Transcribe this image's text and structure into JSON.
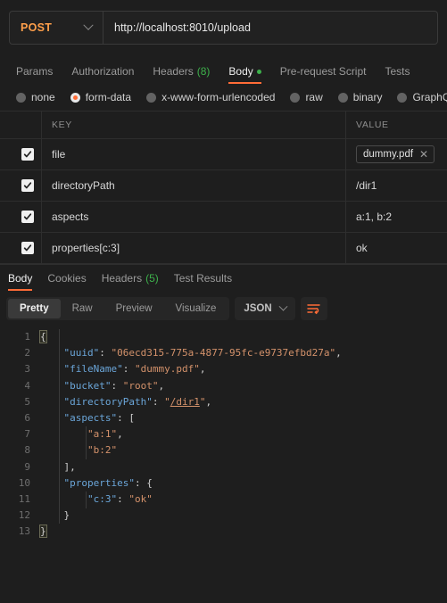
{
  "request": {
    "method": "POST",
    "url": "http://localhost:8010/upload",
    "tabs": [
      {
        "label": "Params",
        "count": "",
        "active": false,
        "dot": false
      },
      {
        "label": "Authorization",
        "count": "",
        "active": false,
        "dot": false
      },
      {
        "label": "Headers",
        "count": "(8)",
        "active": false,
        "dot": false
      },
      {
        "label": "Body",
        "count": "",
        "active": true,
        "dot": true
      },
      {
        "label": "Pre-request Script",
        "count": "",
        "active": false,
        "dot": false
      },
      {
        "label": "Tests",
        "count": "",
        "active": false,
        "dot": false
      }
    ],
    "body_types": [
      {
        "label": "none",
        "selected": false
      },
      {
        "label": "form-data",
        "selected": true
      },
      {
        "label": "x-www-form-urlencoded",
        "selected": false
      },
      {
        "label": "raw",
        "selected": false
      },
      {
        "label": "binary",
        "selected": false
      },
      {
        "label": "GraphQL",
        "selected": false
      }
    ],
    "table": {
      "headers": {
        "key": "KEY",
        "value": "VALUE"
      },
      "rows": [
        {
          "checked": true,
          "key": "file",
          "value": "dummy.pdf",
          "is_file": true
        },
        {
          "checked": true,
          "key": "directoryPath",
          "value": "/dir1",
          "is_file": false
        },
        {
          "checked": true,
          "key": "aspects",
          "value": "a:1, b:2",
          "is_file": false
        },
        {
          "checked": true,
          "key": "properties[c:3]",
          "value": "ok",
          "is_file": false
        }
      ]
    }
  },
  "response": {
    "tabs": [
      {
        "label": "Body",
        "count": "",
        "active": true
      },
      {
        "label": "Cookies",
        "count": "",
        "active": false
      },
      {
        "label": "Headers",
        "count": "(5)",
        "active": false
      },
      {
        "label": "Test Results",
        "count": "",
        "active": false
      }
    ],
    "view_modes": [
      {
        "label": "Pretty",
        "active": true
      },
      {
        "label": "Raw",
        "active": false
      },
      {
        "label": "Preview",
        "active": false
      },
      {
        "label": "Visualize",
        "active": false
      }
    ],
    "format": "JSON",
    "body_json": {
      "uuid": "06ecd315-775a-4877-95fc-e9737efbd27a",
      "fileName": "dummy.pdf",
      "bucket": "root",
      "directoryPath": "/dir1",
      "aspects": [
        "a:1",
        "b:2"
      ],
      "properties": {
        "c:3": "ok"
      }
    },
    "line_numbers": [
      1,
      2,
      3,
      4,
      5,
      6,
      7,
      8,
      9,
      10,
      11,
      12,
      13
    ]
  },
  "icons": {
    "chevron_down": "chevron-down-icon",
    "wrap_lines": "wrap-lines-icon",
    "remove_file": "close-icon",
    "checkmark": "check-icon"
  },
  "colors": {
    "accent": "#ff6c37",
    "method": "#ff9f4a",
    "green": "#3db14b",
    "json_key": "#6ba6d9",
    "json_string": "#d4926b",
    "background": "#1e1e1e"
  }
}
